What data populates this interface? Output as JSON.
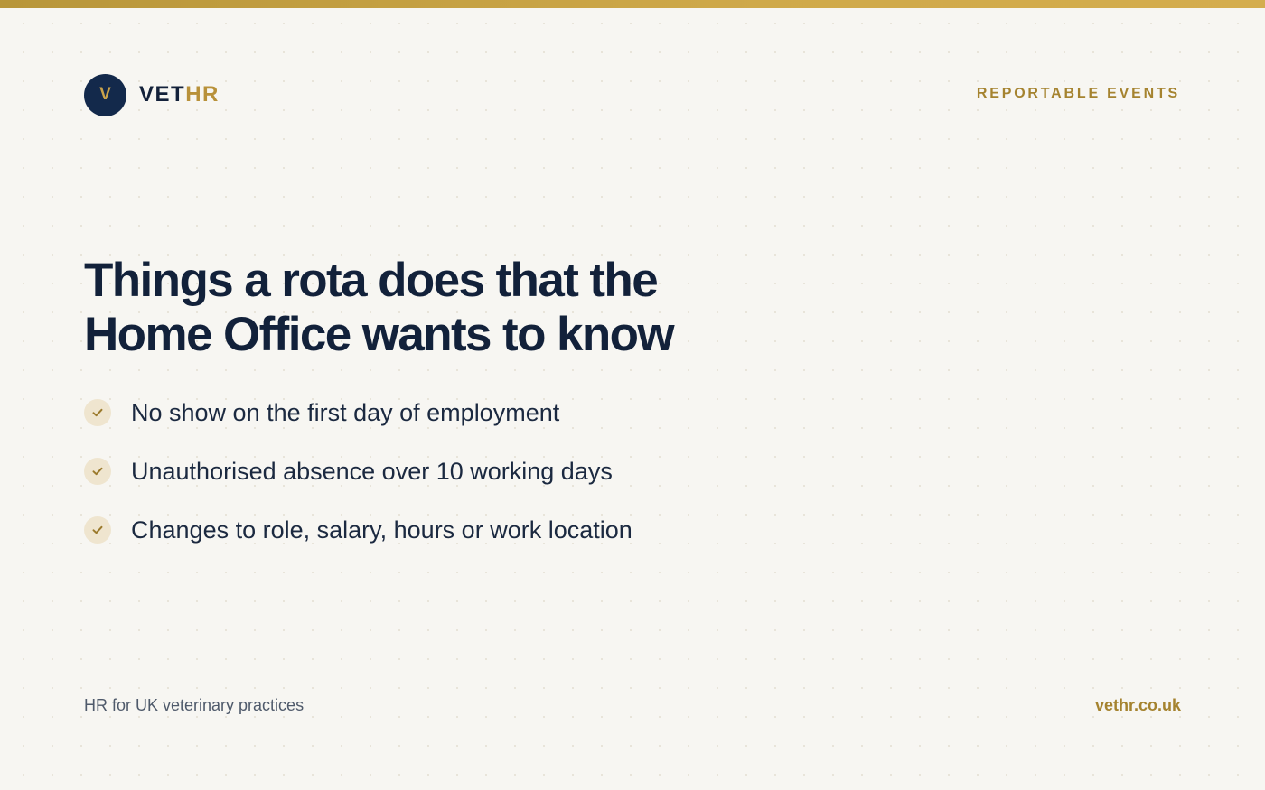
{
  "brand": {
    "logo_letter": "V",
    "name_primary": "VET",
    "name_accent": "HR"
  },
  "header": {
    "section_label": "REPORTABLE EVENTS"
  },
  "main": {
    "headline_line1": "Things a rota does that the",
    "headline_line2": "Home Office wants to know",
    "items": [
      {
        "icon": "check-icon",
        "text": "No show on the first day of employment"
      },
      {
        "icon": "check-icon",
        "text": "Unauthorised absence over 10 working days"
      },
      {
        "icon": "check-icon",
        "text": "Changes to role, salary, hours or work location"
      }
    ]
  },
  "footer": {
    "tagline": "HR for UK veterinary practices",
    "url": "vethr.co.uk"
  },
  "colors": {
    "navy": "#13294b",
    "gold": "#b8913a",
    "background": "#f7f6f2"
  }
}
